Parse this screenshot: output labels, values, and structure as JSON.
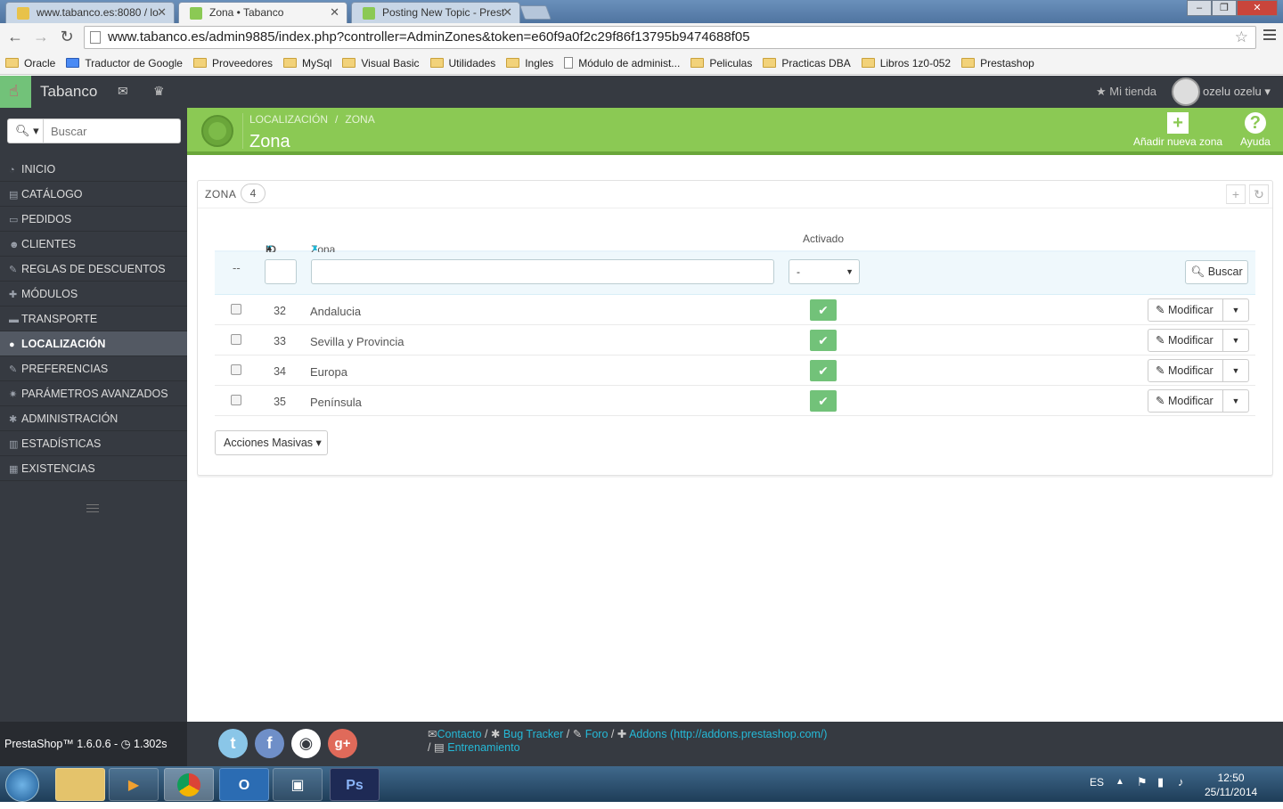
{
  "browser": {
    "tabs": [
      {
        "label": "www.tabanco.es:8080 / lo"
      },
      {
        "label": "Zona • Tabanco"
      },
      {
        "label": "Posting New Topic - Prest"
      }
    ],
    "url": "www.tabanco.es/admin9885/index.php?controller=AdminZones&token=e60f9a0f2c29f86f13795b9474688f05",
    "bookmarks": [
      {
        "label": "Oracle",
        "icon": "folder-icon"
      },
      {
        "label": "Traductor de Google",
        "icon": "translate-icon"
      },
      {
        "label": "Proveedores",
        "icon": "folder-icon"
      },
      {
        "label": "MySql",
        "icon": "folder-icon"
      },
      {
        "label": "Visual Basic",
        "icon": "folder-icon"
      },
      {
        "label": "Utilidades",
        "icon": "folder-icon"
      },
      {
        "label": "Ingles",
        "icon": "folder-icon"
      },
      {
        "label": "Módulo de administ...",
        "icon": "page-icon"
      },
      {
        "label": "Peliculas",
        "icon": "folder-icon"
      },
      {
        "label": "Practicas DBA",
        "icon": "folder-icon"
      },
      {
        "label": "Libros 1z0-052",
        "icon": "folder-icon"
      },
      {
        "label": "Prestashop",
        "icon": "folder-icon"
      }
    ]
  },
  "header": {
    "shop_name": "Tabanco",
    "store_link": "Mi tienda",
    "user": "ozelu ozelu"
  },
  "sidebar": {
    "search_placeholder": "Buscar",
    "items": [
      {
        "label": "INICIO"
      },
      {
        "label": "CATÁLOGO"
      },
      {
        "label": "PEDIDOS"
      },
      {
        "label": "CLIENTES"
      },
      {
        "label": "REGLAS DE DESCUENTOS"
      },
      {
        "label": "MÓDULOS"
      },
      {
        "label": "TRANSPORTE"
      },
      {
        "label": "LOCALIZACIÓN"
      },
      {
        "label": "PREFERENCIAS"
      },
      {
        "label": "PARÁMETROS AVANZADOS"
      },
      {
        "label": "ADMINISTRACIÓN"
      },
      {
        "label": "ESTADÍSTICAS"
      },
      {
        "label": "EXISTENCIAS"
      }
    ]
  },
  "page": {
    "breadcrumb": [
      "LOCALIZACIÓN",
      "ZONA"
    ],
    "title": "Zona",
    "add_button": "Añadir nueva zona",
    "help_button": "Ayuda"
  },
  "panel": {
    "title": "ZONA",
    "count": "4",
    "columns": {
      "id": "ID",
      "zone": "Zona",
      "active": "Activado"
    },
    "filter_dash": "--",
    "filter_select": "-",
    "search_button": "Buscar",
    "rows": [
      {
        "id": "32",
        "name": "Andalucia"
      },
      {
        "id": "33",
        "name": "Sevilla y Provincia"
      },
      {
        "id": "34",
        "name": "Europa"
      },
      {
        "id": "35",
        "name": "Península"
      }
    ],
    "edit_label": "Modificar",
    "bulk_actions": "Acciones Masivas"
  },
  "footer": {
    "version": "PrestaShop™ 1.6.0.6 - ",
    "load_time": "1.302s",
    "links": {
      "contact": "Contacto",
      "bug": "Bug Tracker",
      "forum": "Foro",
      "addons": "Addons (http://addons.prestashop.com/)",
      "training": "Entrenamiento"
    }
  },
  "taskbar": {
    "lang": "ES",
    "time": "12:50",
    "date": "25/11/2014"
  },
  "colors": {
    "accent_green": "#8bc954",
    "active_green": "#72c279",
    "link_blue": "#25b9d7",
    "dark": "#363a41"
  }
}
